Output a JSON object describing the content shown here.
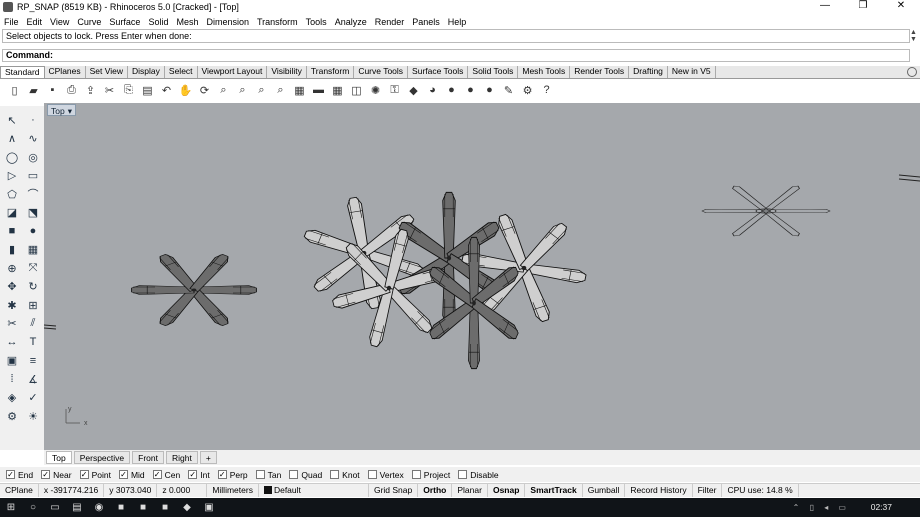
{
  "window": {
    "title": "RP_SNAP (8519 KB) - Rhinoceros 5.0 [Cracked] - [Top]",
    "minimize": "—",
    "maximize": "❐",
    "close": "✕"
  },
  "menu": [
    "File",
    "Edit",
    "View",
    "Curve",
    "Surface",
    "Solid",
    "Mesh",
    "Dimension",
    "Transform",
    "Tools",
    "Analyze",
    "Render",
    "Panels",
    "Help"
  ],
  "command": {
    "history": "Select objects to lock. Press Enter when done:",
    "prompt": "Command:"
  },
  "toolbar_tabs": [
    {
      "label": "Standard",
      "active": true
    },
    {
      "label": "CPlanes"
    },
    {
      "label": "Set View"
    },
    {
      "label": "Display"
    },
    {
      "label": "Select"
    },
    {
      "label": "Viewport Layout"
    },
    {
      "label": "Visibility"
    },
    {
      "label": "Transform"
    },
    {
      "label": "Curve Tools"
    },
    {
      "label": "Surface Tools"
    },
    {
      "label": "Solid Tools"
    },
    {
      "label": "Mesh Tools"
    },
    {
      "label": "Render Tools"
    },
    {
      "label": "Drafting"
    },
    {
      "label": "New in V5"
    }
  ],
  "toolbar_icons": [
    "new-file-icon",
    "open-file-icon",
    "save-icon",
    "print-icon",
    "import-icon",
    "cut-icon",
    "copy-icon",
    "paste-icon",
    "undo-icon",
    "pan-icon",
    "rotate-view-icon",
    "zoom-window-icon",
    "zoom-extents-icon",
    "zoom-selected-icon",
    "zoom-all-icon",
    "four-viewports-icon",
    "car-render-icon",
    "grid-icon",
    "cplane-icon",
    "lightbulb-icon",
    "lock-icon",
    "material-icon",
    "color-wheel-icon",
    "sphere-shade-icon",
    "sphere-render-icon",
    "sphere-blue-icon",
    "flashlight-icon",
    "options-gear-icon",
    "help-icon"
  ],
  "left_tools": [
    "select-point-icon",
    "point-icon",
    "polyline-icon",
    "curve-icon",
    "circle-icon",
    "ellipse-icon",
    "arc-icon",
    "rectangle-icon",
    "polygon-icon",
    "fillet-icon",
    "surface-icon",
    "extrude-icon",
    "box-icon",
    "sphere-icon",
    "cylinder-icon",
    "mesh-icon",
    "boolean-icon",
    "transform-icon",
    "move-icon",
    "rotate-icon",
    "explode-icon",
    "join-icon",
    "trim-icon",
    "split-icon",
    "dimension-icon",
    "text-icon",
    "group-icon",
    "layer-icon",
    "array-icon",
    "analyze-icon",
    "render-icon",
    "check-icon",
    "options-icon",
    "light-icon"
  ],
  "viewport": {
    "name": "Top",
    "axis_label": "y\n|__x"
  },
  "view_tabs": [
    {
      "label": "Top",
      "active": true
    },
    {
      "label": "Perspective"
    },
    {
      "label": "Front"
    },
    {
      "label": "Right"
    },
    {
      "label": "+"
    }
  ],
  "osnaps": [
    {
      "label": "End",
      "checked": true
    },
    {
      "label": "Near",
      "checked": true
    },
    {
      "label": "Point",
      "checked": true
    },
    {
      "label": "Mid",
      "checked": true
    },
    {
      "label": "Cen",
      "checked": true
    },
    {
      "label": "Int",
      "checked": true
    },
    {
      "label": "Perp",
      "checked": true
    },
    {
      "label": "Tan",
      "checked": false
    },
    {
      "label": "Quad",
      "checked": false
    },
    {
      "label": "Knot",
      "checked": false
    },
    {
      "label": "Vertex",
      "checked": false
    },
    {
      "label": "Project",
      "checked": false
    },
    {
      "label": "Disable",
      "checked": false
    }
  ],
  "status": {
    "cplane": "CPlane",
    "x": "x -391774.216",
    "y": "y 3073.040",
    "z": "z 0.000",
    "units": "Millimeters",
    "layer": "Default",
    "grid_snap": "Grid Snap",
    "ortho": "Ortho",
    "planar": "Planar",
    "osnap": "Osnap",
    "smarttrack": "SmartTrack",
    "gumball": "Gumball",
    "history": "Record History",
    "filter": "Filter",
    "cpu": "CPU use: 14.8 %"
  },
  "taskbar": {
    "clock": "02:37"
  },
  "colors": {
    "viewport_bg": "#a5a8ac",
    "accent": "#cfd6e0"
  }
}
